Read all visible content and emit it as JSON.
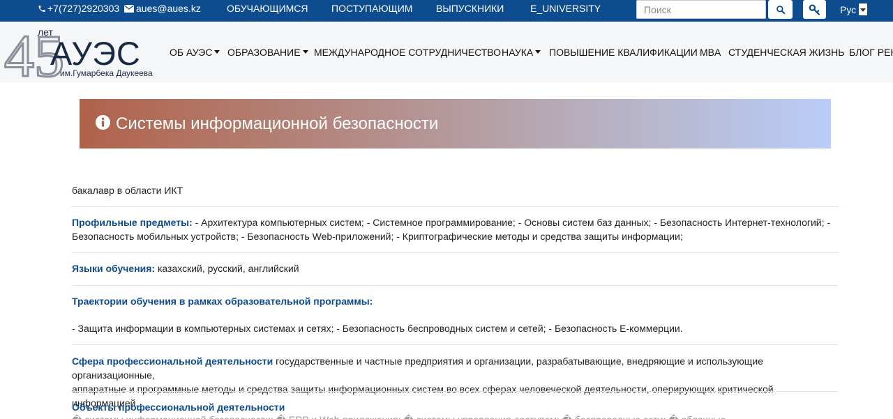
{
  "topbar": {
    "phone": "+7(727)2920303",
    "email": "aues@aues.kz",
    "nav": [
      "ОБУЧАЮЩИМСЯ",
      "ПОСТУПАЮЩИМ",
      "ВЫПУСКНИКИ",
      "E_UNIVERSITY"
    ],
    "search_placeholder": "Поиск",
    "lang": "Рус"
  },
  "logo": {
    "years_number": "45",
    "years_word": "лет",
    "name": "АУЭС",
    "subtitle": "им.Гумарбека Даукеева"
  },
  "mainnav": [
    {
      "label": "ОБ АУЭС",
      "dropdown": true
    },
    {
      "label": "ОБРАЗОВАНИЕ",
      "dropdown": true
    },
    {
      "label": "МЕЖДУНАРОДНОЕ СОТРУДНИЧЕСТВО",
      "dropdown": false
    },
    {
      "label": "НАУКА",
      "dropdown": true
    },
    {
      "label": "ПОВЫШЕНИЕ КВАЛИФИКАЦИИ",
      "dropdown": false
    },
    {
      "label": "MBA",
      "dropdown": false
    },
    {
      "label": "СТУДЕНЧЕСКАЯ ЖИЗНЬ",
      "dropdown": false
    },
    {
      "label": "БЛОГ РЕК",
      "dropdown": false
    }
  ],
  "banner": {
    "title": "Системы информационной безопасности"
  },
  "content": {
    "degree": "бакалавр в области ИКТ",
    "profile_label": "Профильные предметы:",
    "profile_line1": " - Архитектура компьютерных систем; - Системное программирование; - Основы систем баз данных; - Безопасность Интернет-технологий; -",
    "profile_line2": "Безопасность мобильных устройств; - Безопасность Web-приложений; - Криптографические методы и средства защиты информации;",
    "lang_label": "Языки обучения:",
    "lang_value": " казахский, русский, английский",
    "traj_label": "Траектории обучения в рамках образовательной программы:",
    "traj_value": "- Защита информации в компьютерных системах и сетях; - Безопасность беспроводных систем и сетей; - Безопасность Е-коммерции.",
    "sphere_label": "Сфера профессиональной деятельности",
    "sphere_line1": " государственные и частные предприятия и организации, разрабатывающие, внедряющие и использующие организационные,",
    "sphere_line2": "аппаратные и программные методы и средства защиты информационных систем во всех сферах человеческой деятельности, оперирующих критической информацией.",
    "objects_label": "Объекты профессиональной деятельности",
    "objects_partial": "� системы информационной безопасности; � ERP и Web-приложения; � системы управления доступом; � беспроводные сети; � облачные"
  },
  "colors": {
    "topbar": "#0d4c8f",
    "header_bg": "#f5f6f7",
    "label_blue": "#0d4c8f",
    "banner_start": "#b0624a",
    "banner_end": "#b9cdf7"
  },
  "icons": [
    "phone-icon",
    "envelope-icon",
    "search-icon",
    "key-icon",
    "info-circle-icon"
  ]
}
